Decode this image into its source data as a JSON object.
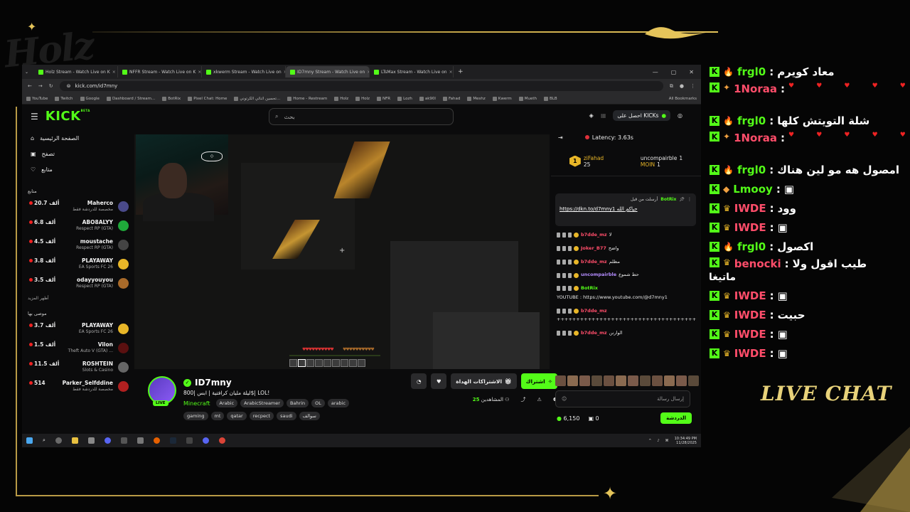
{
  "overlay": {
    "logo_text": "Holz",
    "live_chat_label": "LIVE CHAT"
  },
  "browser": {
    "tabs": [
      {
        "title": "Holz Stream - Watch Live on K",
        "active": false
      },
      {
        "title": "NFFR Stream - Watch Live on K",
        "active": false
      },
      {
        "title": "xkwerm Stream - Watch Live on",
        "active": false
      },
      {
        "title": "ID7mny Stream - Watch Live on",
        "active": true
      },
      {
        "title": "LTsMax Stream - Watch Live on",
        "active": false
      }
    ],
    "url": "kick.com/id7mny",
    "bookmarks": [
      "YouTube",
      "Twitch",
      "Google",
      "Dashboard / Stream...",
      "BotRix",
      "Pixel Chat: Home",
      "تحسين اثنائي الكرتوني...",
      "Home - Restream",
      "Holz",
      "Holz",
      "NFR",
      "Lozh",
      "ak90l",
      "Fahad",
      "Meshz",
      "Kwerm",
      "Mueth",
      "BLB"
    ],
    "all_bookmarks": "All Bookmarks"
  },
  "kick": {
    "logo": "KICK",
    "beta": "BETA",
    "search_placeholder": "بحث",
    "get_kicks": "احصل على KICKs",
    "sidebar": {
      "nav": [
        "الصفحة الرئيسية",
        "تصفح",
        "متابع"
      ],
      "following_header": "متابع",
      "following": [
        {
          "name": "Maherco",
          "category": "مخصصة للدردشة فقط",
          "viewers": "20.7 ألف",
          "color": "#4a4a8a"
        },
        {
          "name": "ABO8ALYY",
          "category": "Respect RP (GTA)",
          "viewers": "6.8 ألف",
          "color": "#1fa83a"
        },
        {
          "name": "moustache",
          "category": "Respect RP (GTA)",
          "viewers": "4.5 ألف",
          "color": "#444"
        },
        {
          "name": "PLAYAWAY",
          "category": "EA Sports FC 26",
          "viewers": "3.8 ألف",
          "color": "#e8b628"
        },
        {
          "name": "odayyouyou",
          "category": "Respect RP (GTA)",
          "viewers": "3.5 ألف",
          "color": "#a86a2a"
        }
      ],
      "show_more": "أظهر المزيد",
      "recommended_header": "موصى بها",
      "recommended": [
        {
          "name": "PLAYAWAY",
          "category": "EA Sports FC 26",
          "viewers": "3.7 ألف",
          "color": "#e8b628"
        },
        {
          "name": "Vilon",
          "category": "Theft Auto V (GTA) ...",
          "viewers": "1.5 ألف",
          "color": "#5a1010"
        },
        {
          "name": "ROSHTEIN",
          "category": "Slots & Casino",
          "viewers": "11.5 ألف",
          "color": "#666"
        },
        {
          "name": "Parker_Selfddine",
          "category": "مخصصة للدردشة فقط",
          "viewers": "514",
          "color": "#b02020"
        }
      ]
    },
    "streamer": {
      "name": "ID7mny",
      "title": "ليلة مليان كرافتية | ابس |800$| LOL!",
      "category": "Minecraft",
      "tags": [
        "Arabic",
        "ArabicStreamer",
        "Bahrin",
        "OL",
        "arabic"
      ],
      "tags2": [
        "gaming",
        "mt",
        "qatar",
        "recpect",
        "saudi",
        "سوالف"
      ],
      "live": "LIVE",
      "subscribe": "اشتراك",
      "gift_subs": "الاشتراكات الهداة",
      "viewers_label": "المشاهدين",
      "viewers_count": "25"
    },
    "game_hud": {
      "hearts": "♥♥♥♥♥♥♥♥♥♥",
      "food": "♥♥♥♥♥♥♥♥♥♥"
    },
    "chat": {
      "latency": "Latency: 3.63s",
      "leaders": [
        {
          "name": "uncompairble",
          "count": "1",
          "sub": "MOIN",
          "sub_count": "1"
        },
        {
          "name": "ziFahad",
          "count": "25"
        }
      ],
      "pinned": {
        "by": "أرسلت من قبل",
        "user": "BotRix",
        "text": "حياكم الله",
        "link": "https://dkn.to/d7mny1"
      },
      "messages": [
        {
          "user": "b7dde_mz",
          "text": "لا",
          "color": "#ff4d6a"
        },
        {
          "user": "Joker_B77",
          "text": "واضح",
          "color": "#ff4d6a"
        },
        {
          "user": "b7dde_mz",
          "text": "مظلم",
          "color": "#ff4d6a"
        },
        {
          "user": "uncompairble",
          "text": "حط شموع",
          "color": "#b48cff"
        },
        {
          "user": "BotRix",
          "text": "YOUTUBE : https://www.youtube.com/@d7mny1",
          "color": "#53fc18"
        },
        {
          "user": "b7dde_mz",
          "text": "++++++++++++++++++++++++++++++++++++",
          "color": "#ff4d6a"
        },
        {
          "user": "b7dde_mz",
          "text": "الوارنن",
          "color": "#ff4d6a"
        }
      ],
      "input_placeholder": "إرسال رسالة",
      "points": "6,150",
      "zero": "0",
      "send": "الدردشة"
    }
  },
  "taskbar": {
    "time": "10:34:49 PM",
    "date": "11/28/2025"
  },
  "overlay_chat": [
    {
      "user": "frgl0",
      "text": "معاد كويرم",
      "color": "#ffffff",
      "badge": "🔥"
    },
    {
      "user": "1Noraa",
      "text": "♥ ♥ ♥ ♥ ♥",
      "color": "#ff4d6a",
      "badge": "✦"
    },
    {
      "user": "frgl0",
      "text": "شلة التويتش كلها",
      "color": "#ffffff",
      "badge": "🔥"
    },
    {
      "user": "1Noraa",
      "text": "♥ ♥ ♥ ♥ ♥",
      "color": "#ff4d6a",
      "badge": "✦"
    },
    {
      "user": "frgl0",
      "text": "امصول هه مو لين هناك",
      "color": "#ffffff",
      "badge": "🔥"
    },
    {
      "user": "Lmooy",
      "text": "▣",
      "color": "#ffffff",
      "badge": "◆"
    },
    {
      "user": "IWDE",
      "text": "وود",
      "color": "#ff4d6a",
      "badge": "♛"
    },
    {
      "user": "IWDE",
      "text": "▣",
      "color": "#ff4d6a",
      "badge": "♛"
    },
    {
      "user": "frgl0",
      "text": "اكصول",
      "color": "#ffffff",
      "badge": "🔥"
    },
    {
      "user": "benocki",
      "text": "طيب اقول ولا",
      "color": "#ff4d6a",
      "badge": "♛",
      "extra": "ماتيغا"
    },
    {
      "user": "IWDE",
      "text": "▣",
      "color": "#ff4d6a",
      "badge": "♛"
    },
    {
      "user": "IWDE",
      "text": "حبيت",
      "color": "#ff4d6a",
      "badge": "♛"
    },
    {
      "user": "IWDE",
      "text": "▣",
      "color": "#ff4d6a",
      "badge": "♛"
    },
    {
      "user": "IWDE",
      "text": "▣",
      "color": "#ff4d6a",
      "badge": "♛"
    }
  ],
  "colors": {
    "kick_green": "#53fc18",
    "gold": "#c8a94a"
  }
}
